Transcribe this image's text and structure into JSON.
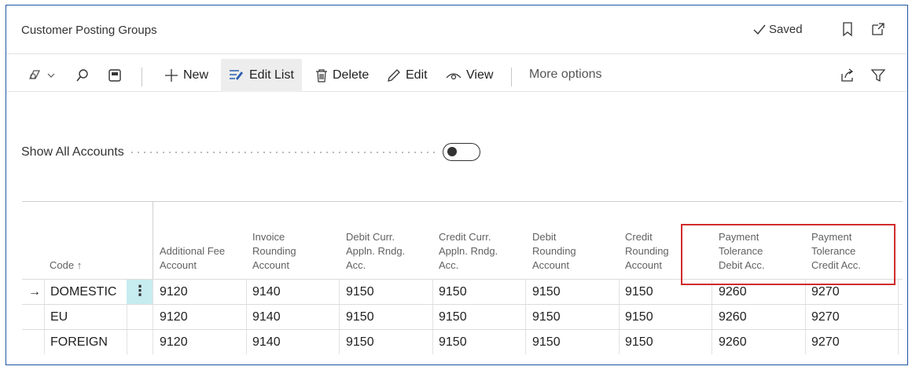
{
  "title": "Customer Posting Groups",
  "status": {
    "saved_label": "Saved"
  },
  "actions": {
    "new": "New",
    "edit_list": "Edit List",
    "delete": "Delete",
    "edit": "Edit",
    "view": "View",
    "more_options": "More options"
  },
  "filter": {
    "show_all_accounts_label": "Show All Accounts",
    "toggle_on": false
  },
  "columns": {
    "code": "Code",
    "sort_indicator": "↑",
    "additional_fee": [
      "Additional Fee",
      "Account"
    ],
    "invoice_rounding": [
      "Invoice",
      "Rounding",
      "Account"
    ],
    "debit_curr": [
      "Debit Curr.",
      "Appln. Rndg.",
      "Acc."
    ],
    "credit_curr": [
      "Credit Curr.",
      "Appln. Rndg.",
      "Acc."
    ],
    "debit_rounding": [
      "Debit",
      "Rounding",
      "Account"
    ],
    "credit_rounding": [
      "Credit",
      "Rounding",
      "Account"
    ],
    "pmt_tol_debit": [
      "Payment",
      "Tolerance",
      "Debit Acc."
    ],
    "pmt_tol_credit": [
      "Payment",
      "Tolerance",
      "Credit Acc."
    ]
  },
  "rows": [
    {
      "code": "DOMESTIC",
      "additional_fee": "9120",
      "invoice_rounding": "9140",
      "debit_curr": "9150",
      "credit_curr": "9150",
      "debit_rounding": "9150",
      "credit_rounding": "9150",
      "pmt_tol_debit": "9260",
      "pmt_tol_credit": "9270"
    },
    {
      "code": "EU",
      "additional_fee": "9120",
      "invoice_rounding": "9140",
      "debit_curr": "9150",
      "credit_curr": "9150",
      "debit_rounding": "9150",
      "credit_rounding": "9150",
      "pmt_tol_debit": "9260",
      "pmt_tol_credit": "9270"
    },
    {
      "code": "FOREIGN",
      "additional_fee": "9120",
      "invoice_rounding": "9140",
      "debit_curr": "9150",
      "credit_curr": "9150",
      "debit_rounding": "9150",
      "credit_rounding": "9150",
      "pmt_tol_debit": "9260",
      "pmt_tol_credit": "9270"
    }
  ],
  "selected_row_marker": "→",
  "row_menu_glyph": "⋮",
  "colors": {
    "accent": "#1f56a8",
    "highlight": "#d22b2b",
    "selected_cell": "#c7ecf0"
  }
}
